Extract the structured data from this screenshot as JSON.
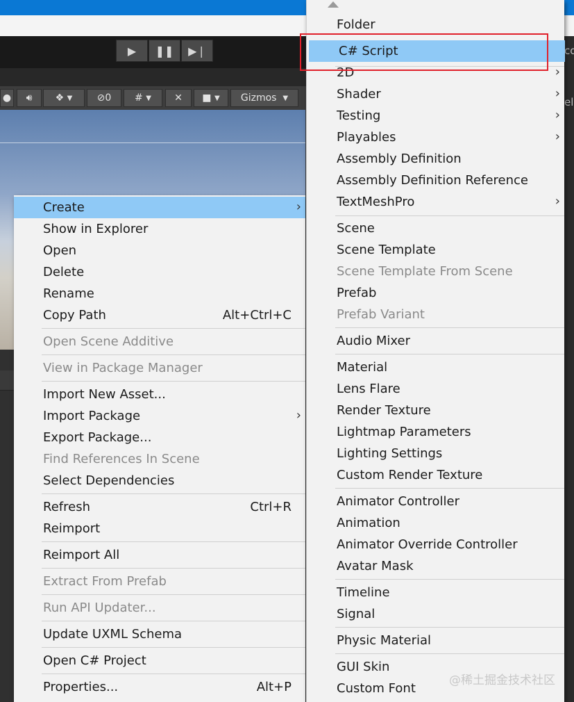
{
  "toolbar": {
    "play_icon": "play-icon",
    "pause_icon": "pause-icon",
    "step_icon": "step-icon"
  },
  "scene_toolbar": {
    "visibility_count": "0",
    "gizmos_label": "Gizmos"
  },
  "right_panel_fragments": {
    "top": "co",
    "second": "el"
  },
  "context_menu": {
    "items": [
      {
        "label": "Create",
        "has_submenu": true,
        "highlighted": true
      },
      {
        "label": "Show in Explorer"
      },
      {
        "label": "Open"
      },
      {
        "label": "Delete"
      },
      {
        "label": "Rename"
      },
      {
        "label": "Copy Path",
        "shortcut": "Alt+Ctrl+C"
      },
      {
        "label": "Open Scene Additive",
        "disabled": true
      },
      {
        "label": "View in Package Manager",
        "disabled": true
      },
      {
        "label": "Import New Asset..."
      },
      {
        "label": "Import Package",
        "has_submenu": true
      },
      {
        "label": "Export Package..."
      },
      {
        "label": "Find References In Scene",
        "disabled": true
      },
      {
        "label": "Select Dependencies"
      },
      {
        "label": "Refresh",
        "shortcut": "Ctrl+R"
      },
      {
        "label": "Reimport"
      },
      {
        "label": "Reimport All"
      },
      {
        "label": "Extract From Prefab",
        "disabled": true
      },
      {
        "label": "Run API Updater...",
        "disabled": true
      },
      {
        "label": "Update UXML Schema"
      },
      {
        "label": "Open C# Project"
      },
      {
        "label": "Properties...",
        "shortcut": "Alt+P"
      }
    ]
  },
  "create_submenu": {
    "items": [
      {
        "label": "Folder"
      },
      {
        "label": "C# Script",
        "highlighted": true,
        "annotated": true
      },
      {
        "label": "2D",
        "has_submenu": true
      },
      {
        "label": "Shader",
        "has_submenu": true
      },
      {
        "label": "Testing",
        "has_submenu": true
      },
      {
        "label": "Playables",
        "has_submenu": true
      },
      {
        "label": "Assembly Definition"
      },
      {
        "label": "Assembly Definition Reference"
      },
      {
        "label": "TextMeshPro",
        "has_submenu": true
      },
      {
        "label": "Scene"
      },
      {
        "label": "Scene Template"
      },
      {
        "label": "Scene Template From Scene",
        "disabled": true
      },
      {
        "label": "Prefab"
      },
      {
        "label": "Prefab Variant",
        "disabled": true
      },
      {
        "label": "Audio Mixer"
      },
      {
        "label": "Material"
      },
      {
        "label": "Lens Flare"
      },
      {
        "label": "Render Texture"
      },
      {
        "label": "Lightmap Parameters"
      },
      {
        "label": "Lighting Settings"
      },
      {
        "label": "Custom Render Texture"
      },
      {
        "label": "Animator Controller"
      },
      {
        "label": "Animation"
      },
      {
        "label": "Animator Override Controller"
      },
      {
        "label": "Avatar Mask"
      },
      {
        "label": "Timeline"
      },
      {
        "label": "Signal"
      },
      {
        "label": "Physic Material"
      },
      {
        "label": "GUI Skin"
      },
      {
        "label": "Custom Font"
      }
    ]
  },
  "annotation": {
    "color": "#e0202a"
  },
  "watermark": "@稀土掘金技术社区",
  "colors": {
    "menu_bg": "#f2f2f2",
    "highlight": "#8fc9f6",
    "disabled_text": "#8a8a8a",
    "toolbar_bg": "#191919"
  }
}
